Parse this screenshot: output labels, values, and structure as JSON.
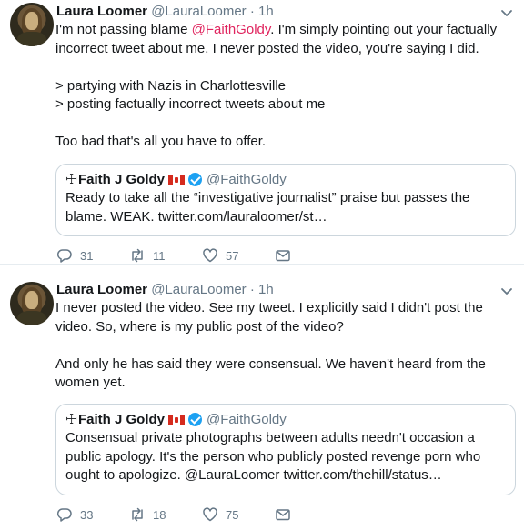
{
  "tweets": [
    {
      "author_name": "Laura Loomer",
      "author_handle": "@LauraLoomer",
      "separator": "·",
      "time": "1h",
      "text_pre": "I'm not passing blame ",
      "text_mention": "@FaithGoldy",
      "text_post": ". I'm simply pointing out your factually incorrect tweet about me. I never posted the video, you're saying I did.",
      "line2": "> partying with Nazis in Charlottesville",
      "line3": "> posting factually incorrect tweets about me",
      "line4": "Too bad that's all you have to offer.",
      "quote": {
        "cross": "☩",
        "name": "Faith J Goldy",
        "handle": "@FaithGoldy",
        "text": "Ready to take all the “investigative journalist” praise but passes the blame. WEAK. twitter.com/lauraloomer/st…"
      },
      "replies": "31",
      "retweets": "11",
      "likes": "57"
    },
    {
      "author_name": "Laura Loomer",
      "author_handle": "@LauraLoomer",
      "separator": "·",
      "time": "1h",
      "text1": "I never posted the video. See my tweet. I explicitly said I didn't post the video. So, where is my public post of the video?",
      "text2": "And only he has said they were consensual. We haven't heard from the women yet.",
      "quote": {
        "cross": "☩",
        "name": "Faith J Goldy",
        "handle": "@FaithGoldy",
        "text": "Consensual private photographs between adults needn't occasion a public apology. It's the person who publicly posted revenge porn who ought to apologize. @LauraLoomer twitter.com/thehill/status…"
      },
      "replies": "33",
      "retweets": "18",
      "likes": "75"
    }
  ]
}
